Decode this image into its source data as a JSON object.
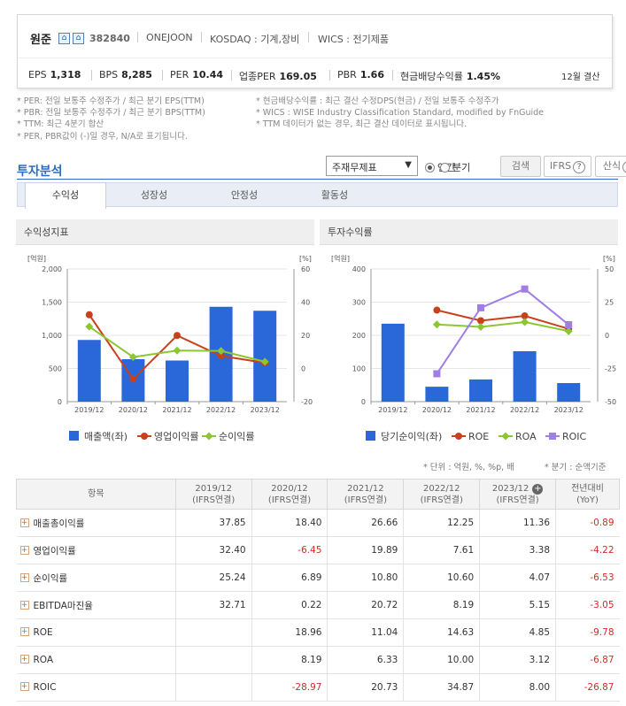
{
  "company": {
    "name": "원준",
    "code": "382840",
    "eng_name": "ONEJOON",
    "market": "KOSDAQ : 기계,장비",
    "wics": "WICS : 전기제품",
    "settle": "12월 결산"
  },
  "kpis": [
    {
      "label": "EPS",
      "value": "1,318"
    },
    {
      "label": "BPS",
      "value": "8,285"
    },
    {
      "label": "PER",
      "value": "10.44"
    },
    {
      "label": "업종PER",
      "value": "169.05"
    },
    {
      "label": "PBR",
      "value": "1.66"
    },
    {
      "label": "현금배당수익률",
      "value": "1.45%"
    }
  ],
  "notes_left": [
    "* PER: 전일 보통주 수정주가 / 최근 분기 EPS(TTM)",
    "* PBR: 전일 보통주 수정주가 / 최근 분기 BPS(TTM)",
    "* TTM: 최근 4분기 합산",
    "* PER, PBR값이 (-)일 경우, N/A로 표기됩니다."
  ],
  "notes_right": [
    "* 현금배당수익률 : 최근 결산 수정DPS(현금) / 전일 보통주 수정주가",
    "* WICS : WISE Industry Classification Standard, modified by FnGuide",
    "* TTM 데이터가 없는 경우, 최근 결산 데이터로 표시됩니다."
  ],
  "section_title": "투자분석",
  "controls": {
    "select_value": "주재무제표",
    "radio_annual": "연간",
    "radio_quarter": "분기",
    "search": "검색",
    "ifrs": "IFRS",
    "formula": "산식"
  },
  "tabs": [
    "수익성",
    "성장성",
    "안정성",
    "활동성"
  ],
  "panel_left_title": "수익성지표",
  "panel_right_title": "투자수익률",
  "units_note": "* 단위 : 억원, %, %p, 배",
  "quarter_note": "* 분기 : 순액기준",
  "colors": {
    "bar": "#2a67d8",
    "op": "#c8401c",
    "net": "#8cc630",
    "roic": "#a07ee3",
    "neg": "#d42a2a",
    "accent": "#2b6cc4"
  },
  "chart_data": [
    {
      "type": "bar",
      "categories": [
        "2019/12",
        "2020/12",
        "2021/12",
        "2022/12",
        "2023/12"
      ],
      "y_left_label": "[억원]",
      "y_right_label": "[%]",
      "y_left_ticks": [
        "2,000",
        "1,500",
        "1,000",
        "500",
        "0"
      ],
      "y_right_ticks": [
        "60",
        "40",
        "20",
        "0",
        "-20"
      ],
      "ylim_left": [
        0,
        2000
      ],
      "ylim_right": [
        -20,
        60
      ],
      "series": [
        {
          "name": "매출액(좌)",
          "kind": "bar",
          "axis": "left",
          "values": [
            930,
            640,
            620,
            1430,
            1370
          ]
        },
        {
          "name": "영업이익률",
          "kind": "line",
          "axis": "right",
          "values": [
            32.4,
            -6.45,
            19.89,
            7.61,
            3.38
          ]
        },
        {
          "name": "순이익률",
          "kind": "line",
          "axis": "right",
          "values": [
            25.24,
            6.89,
            10.8,
            10.6,
            4.07
          ]
        }
      ]
    },
    {
      "type": "bar",
      "categories": [
        "2019/12",
        "2020/12",
        "2021/12",
        "2022/12",
        "2023/12"
      ],
      "y_left_label": "[억원]",
      "y_right_label": "[%]",
      "y_left_ticks": [
        "400",
        "300",
        "200",
        "100",
        "0"
      ],
      "y_right_ticks": [
        "50",
        "25",
        "0",
        "-25",
        "-50"
      ],
      "ylim_left": [
        0,
        400
      ],
      "ylim_right": [
        -50,
        50
      ],
      "series": [
        {
          "name": "당기순이익(좌)",
          "kind": "bar",
          "axis": "left",
          "values": [
            235,
            45,
            67,
            152,
            56
          ]
        },
        {
          "name": "ROE",
          "kind": "line",
          "axis": "right",
          "values": [
            null,
            18.96,
            11.04,
            14.63,
            4.85
          ]
        },
        {
          "name": "ROA",
          "kind": "line",
          "axis": "right",
          "values": [
            null,
            8.19,
            6.33,
            10.0,
            3.12
          ]
        },
        {
          "name": "ROIC",
          "kind": "line",
          "axis": "right",
          "values": [
            null,
            -28.97,
            20.73,
            34.87,
            8.0
          ]
        }
      ]
    }
  ],
  "table": {
    "header_item": "항목",
    "columns": [
      {
        "year": "2019/12",
        "sub": "(IFRS연결)"
      },
      {
        "year": "2020/12",
        "sub": "(IFRS연결)"
      },
      {
        "year": "2021/12",
        "sub": "(IFRS연결)"
      },
      {
        "year": "2022/12",
        "sub": "(IFRS연결)"
      },
      {
        "year": "2023/12",
        "sub": "(IFRS연결)"
      },
      {
        "year": "전년대비",
        "sub": "(YoY)"
      }
    ],
    "rows": [
      {
        "label": "매출총이익률",
        "values": [
          "37.85",
          "18.40",
          "26.66",
          "12.25",
          "11.36",
          "-0.89"
        ]
      },
      {
        "label": "영업이익률",
        "values": [
          "32.40",
          "-6.45",
          "19.89",
          "7.61",
          "3.38",
          "-4.22"
        ]
      },
      {
        "label": "순이익률",
        "values": [
          "25.24",
          "6.89",
          "10.80",
          "10.60",
          "4.07",
          "-6.53"
        ]
      },
      {
        "label": "EBITDA마진율",
        "values": [
          "32.71",
          "0.22",
          "20.72",
          "8.19",
          "5.15",
          "-3.05"
        ]
      },
      {
        "label": "ROE",
        "values": [
          "",
          "18.96",
          "11.04",
          "14.63",
          "4.85",
          "-9.78"
        ]
      },
      {
        "label": "ROA",
        "values": [
          "",
          "8.19",
          "6.33",
          "10.00",
          "3.12",
          "-6.87"
        ]
      },
      {
        "label": "ROIC",
        "values": [
          "",
          "-28.97",
          "20.73",
          "34.87",
          "8.00",
          "-26.87"
        ]
      }
    ]
  }
}
